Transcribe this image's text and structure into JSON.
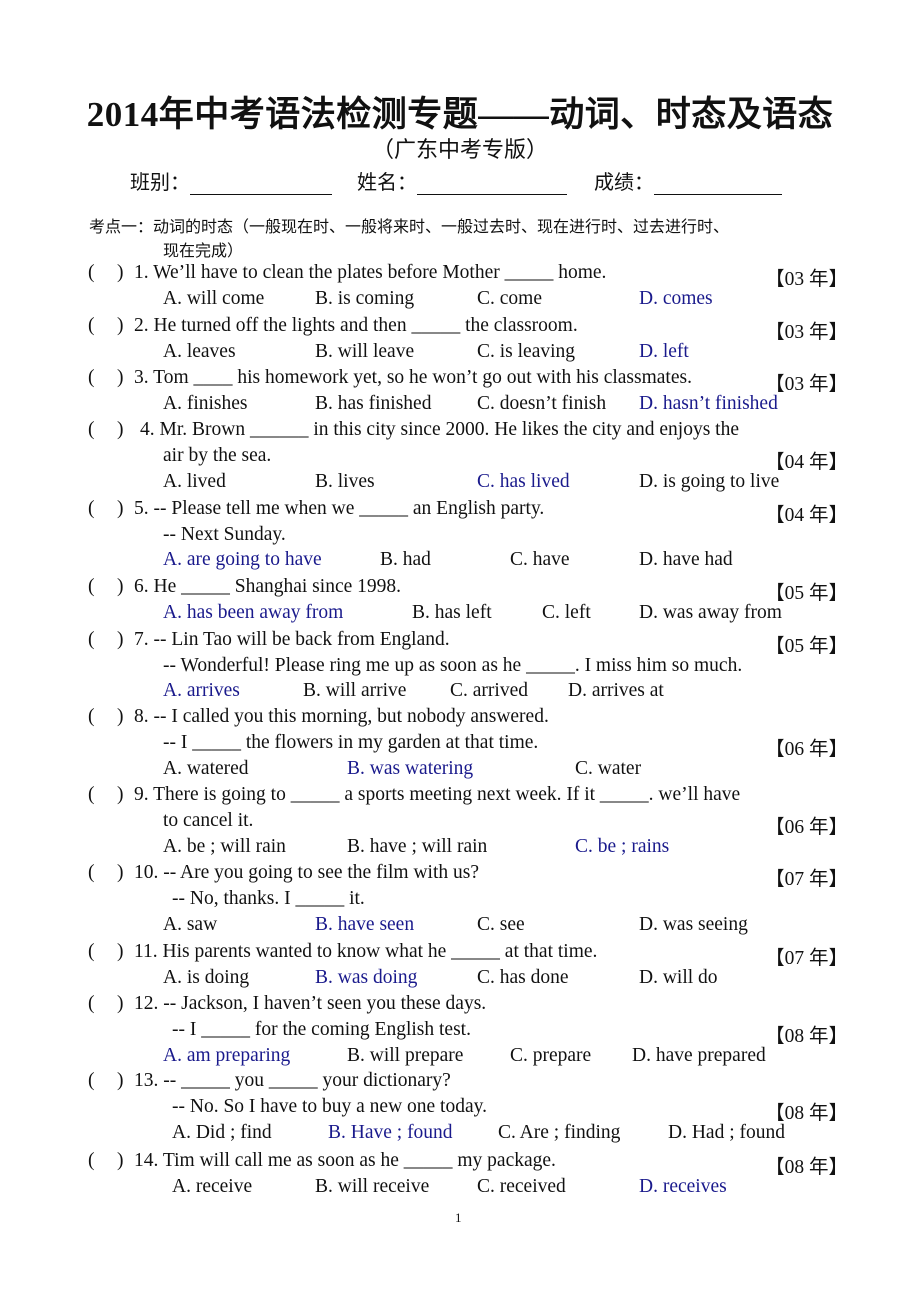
{
  "header": {
    "title": "2014年中考语法检测专题——动词、时态及语态",
    "subtitle": "（广东中考专版）",
    "fields": [
      {
        "label": "班别："
      },
      {
        "label": "姓名："
      },
      {
        "label": "成绩："
      }
    ]
  },
  "section": {
    "line1": "考点一：动词的时态（一般现在时、一般将来时、一般过去时、现在进行时、过去进行时、",
    "line2": "现在完成）"
  },
  "answer_color": "#1a1a8c",
  "questions": [
    {
      "paren": "(",
      "close": ")",
      "stem": "1. We’ll have to clean the plates before Mother _____ home.",
      "year": "【03 年】",
      "options": [
        "A. will come",
        "B. is coming",
        "C. come",
        "D. comes"
      ],
      "answer": "D"
    },
    {
      "paren": "(",
      "close": ")",
      "stem": "2. He turned off the lights and then _____ the classroom.",
      "year": "【03 年】",
      "options": [
        "A. leaves",
        "B. will leave",
        "C. is leaving",
        "D. left"
      ],
      "answer": "D"
    },
    {
      "paren": "(",
      "close": ")",
      "stem": "3. Tom ____ his homework yet, so he won’t go out with his classmates.",
      "year": "【03 年】",
      "options": [
        "A. finishes",
        "B. has finished",
        "C. doesn’t finish",
        "D. hasn’t finished"
      ],
      "answer": "D"
    },
    {
      "paren": "(",
      "close": ")",
      "stem": "4. Mr. Brown ______ in this city since 2000. He likes the city and enjoys the",
      "stem2": "air by the sea.",
      "year": "【04 年】",
      "options": [
        "A. lived",
        "B. lives",
        "C. has lived",
        "D. is going to live"
      ],
      "answer": "C"
    },
    {
      "paren": "(",
      "close": ")",
      "stem": "5. -- Please tell me when we _____ an English party.",
      "stem2": "-- Next Sunday.",
      "year": "【04 年】",
      "options": [
        "A. are going to have",
        "B. had",
        "C. have",
        "D. have had"
      ],
      "answer": "A"
    },
    {
      "paren": "(",
      "close": ")",
      "stem": "6. He _____ Shanghai since 1998.",
      "year": "【05 年】",
      "options": [
        "A. has been away from",
        "B. has left",
        "C. left",
        "D. was away from"
      ],
      "answer": "A"
    },
    {
      "paren": "(",
      "close": ")",
      "stem": "7. -- Lin Tao will be back from England.",
      "stem2": "-- Wonderful! Please ring me up as soon as he _____. I miss him so much.",
      "year": "【05 年】",
      "options": [
        "A. arrives",
        "B. will arrive",
        "C. arrived",
        "D. arrives at"
      ],
      "answer": "A"
    },
    {
      "paren": "(",
      "close": ")",
      "stem": "8. -- I called you this morning, but nobody answered.",
      "stem2": "-- I _____ the flowers in my garden at that time.",
      "year": "【06 年】",
      "options": [
        "A. watered",
        "B. was watering",
        "C. water"
      ],
      "answer": "B"
    },
    {
      "paren": "(",
      "close": ")",
      "stem": "9. There is going to _____ a sports meeting next week. If it _____. we’ll have",
      "stem2": "to cancel it.",
      "year": "【06 年】",
      "options": [
        "A. be ; will rain",
        "B. have ; will rain",
        "C. be ; rains"
      ],
      "answer": "C"
    },
    {
      "paren": "(",
      "close": ")",
      "stem": "10. -- Are you going to see the film with us?",
      "stem2": "-- No, thanks. I _____ it.",
      "year": "【07 年】",
      "options": [
        "A. saw",
        "B. have seen",
        "C. see",
        "D. was seeing"
      ],
      "answer": "B"
    },
    {
      "paren": "(",
      "close": ")",
      "stem": "11. His parents wanted to know what he _____ at that time.",
      "year": "【07 年】",
      "options": [
        "A. is doing",
        "B. was doing",
        "C. has done",
        "D. will do"
      ],
      "answer": "B"
    },
    {
      "paren": "(",
      "close": ")",
      "stem": "12. -- Jackson, I haven’t seen you these days.",
      "stem2": "-- I _____ for the coming English test.",
      "year": "【08 年】",
      "options": [
        "A. am preparing",
        "B. will prepare",
        "C. prepare",
        "D. have prepared"
      ],
      "answer": "A"
    },
    {
      "paren": "(",
      "close": ")",
      "stem": "13. -- _____ you _____ your dictionary?",
      "stem2": "-- No. So I have to buy a new one today.",
      "year": "【08 年】",
      "options": [
        "A. Did ; find",
        "B. Have ; found",
        "C. Are ; finding",
        "D. Had ; found"
      ],
      "answer": "B"
    },
    {
      "paren": "(",
      "close": ")",
      "stem": "14. Tim will call me as soon as he _____ my package.",
      "year": "【08 年】",
      "options": [
        "A. receive",
        "B. will receive",
        "C. received",
        "D. receives"
      ],
      "answer": "D"
    }
  ],
  "footer": {
    "page_number": "1"
  }
}
